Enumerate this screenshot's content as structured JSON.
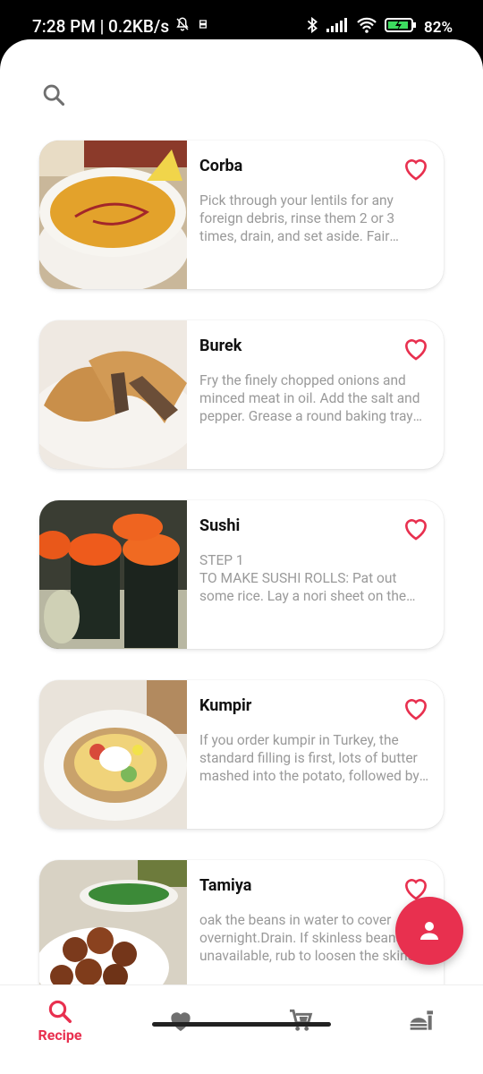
{
  "status_bar": {
    "time_speed": "7:28 PM | 0.2KB/s",
    "battery": "82%"
  },
  "search": {
    "icon": "search-icon"
  },
  "recipes": [
    {
      "title": "Corba",
      "description": "Pick through your lentils for any foreign debris, rinse them 2 or 3 times, drain, and set aside.  Fair warning, this will probably turn your lentils into a puree.",
      "favorite_icon": "heart-outline-icon"
    },
    {
      "title": "Burek",
      "description": "Fry the finely chopped onions and minced meat in oil. Add the salt and pepper. Grease a round baking tray with oil.",
      "favorite_icon": "heart-outline-icon"
    },
    {
      "title": "Sushi",
      "description": "STEP 1\nTO MAKE SUSHI ROLLS: Pat out some rice. Lay a nori sheet on the mat.",
      "favorite_icon": "heart-outline-icon"
    },
    {
      "title": "Kumpir",
      "description": "If you order kumpir in Turkey, the standard filling is first, lots of butter mashed into the potato, followed by cheese.",
      "favorite_icon": "heart-outline-icon"
    },
    {
      "title": "Tamiya",
      "description": "oak the beans in water to cover overnight.Drain. If skinless beans are unavailable, rub to loosen the skins.",
      "favorite_icon": "heart-outline-icon"
    }
  ],
  "fab": {
    "icon": "person-icon"
  },
  "bottom_nav": {
    "items": [
      {
        "icon": "search-icon",
        "label": "Recipe",
        "active": true
      },
      {
        "icon": "heart-icon",
        "label": "",
        "active": false
      },
      {
        "icon": "cart-icon",
        "label": "",
        "active": false
      },
      {
        "icon": "food-icon",
        "label": "",
        "active": false
      }
    ]
  },
  "colors": {
    "accent": "#e8304f",
    "muted_icon": "#6f6f6f",
    "desc_text": "#9a9a9a"
  }
}
